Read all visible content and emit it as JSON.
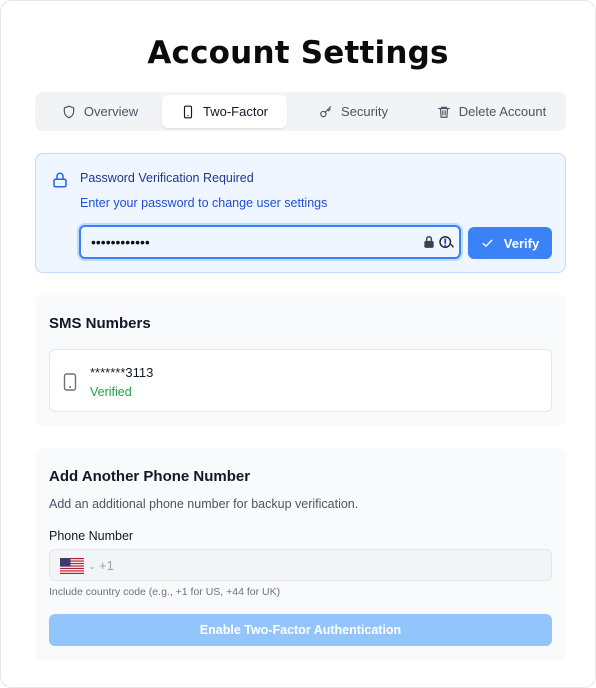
{
  "page": {
    "title": "Account Settings"
  },
  "tabs": [
    {
      "label": "Overview",
      "icon": "shield-icon",
      "active": false
    },
    {
      "label": "Two-Factor",
      "icon": "phone-icon",
      "active": true
    },
    {
      "label": "Security",
      "icon": "key-icon",
      "active": false
    },
    {
      "label": "Delete Account",
      "icon": "trash-icon",
      "active": false
    }
  ],
  "verification": {
    "title": "Password Verification Required",
    "subtitle": "Enter your password to change user settings",
    "password_value": "••••••••••••",
    "verify_label": "Verify"
  },
  "sms": {
    "title": "SMS Numbers",
    "numbers": [
      {
        "number": "*******3113",
        "status": "Verified"
      }
    ]
  },
  "add_phone": {
    "title": "Add Another Phone Number",
    "description": "Add an additional phone number for backup verification.",
    "field_label": "Phone Number",
    "country_flag": "us-flag-icon",
    "placeholder": "+1",
    "hint": "Include country code (e.g., +1 for US, +44 for UK)",
    "button_label": "Enable Two-Factor Authentication"
  },
  "colors": {
    "accent": "#3b82f6",
    "accent_disabled": "#93c5fd",
    "success": "#16a34a",
    "info_bg": "#eff6ff"
  }
}
